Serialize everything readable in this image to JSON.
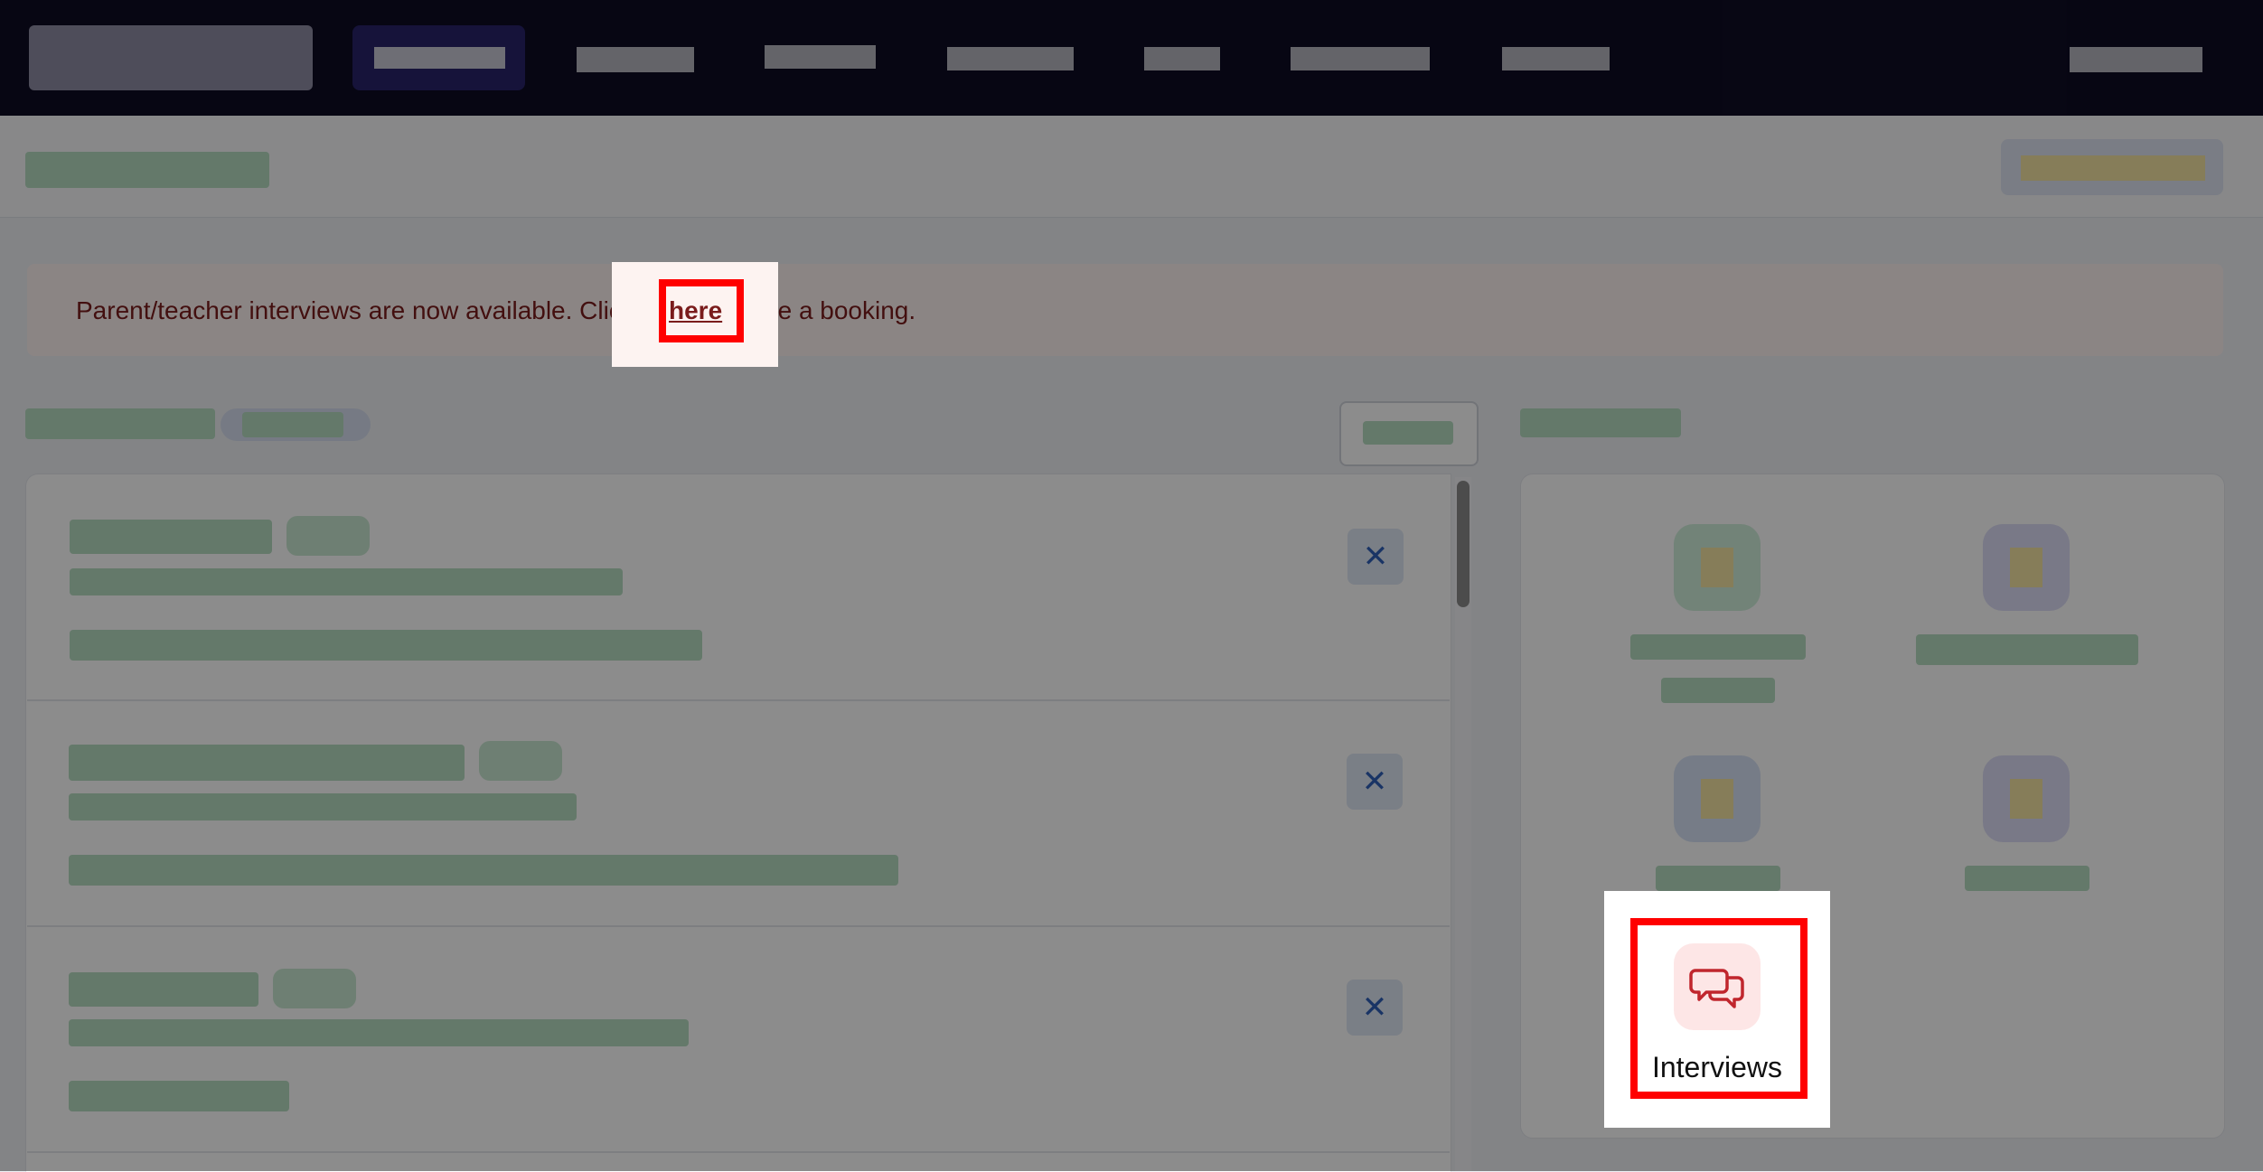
{
  "banner": {
    "text_before": "Parent/teacher interviews are now available. Click ",
    "link_text": "here",
    "text_after": " to make a booking."
  },
  "quick_links": {
    "interviews": {
      "label": "Interviews",
      "icon": "chat-bubbles-icon"
    }
  },
  "colors": {
    "nav_bg": "#0e0c24",
    "banner_bg": "#fdf3f1",
    "banner_text": "#7a1c1c",
    "highlight": "#ff0000",
    "interviews_icon": "#c0262d"
  }
}
